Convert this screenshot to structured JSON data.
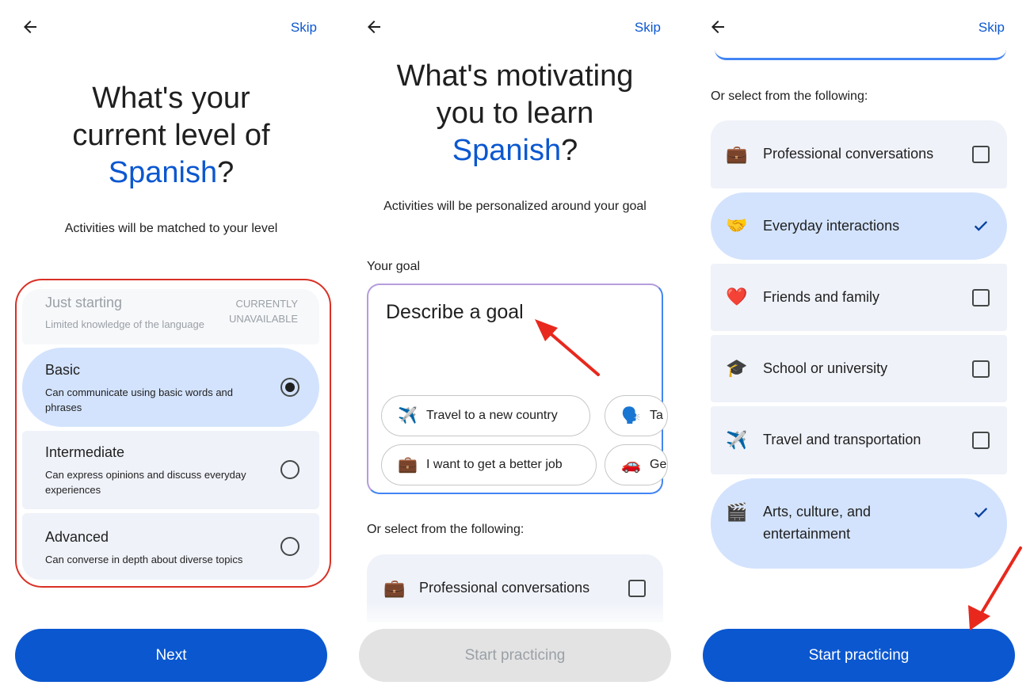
{
  "panel1": {
    "skip": "Skip",
    "title_pre": "What's your current level of",
    "title_hl": "Spanish",
    "title_post": "?",
    "subtitle": "Activities will be matched to your level",
    "levels": [
      {
        "title": "Just starting",
        "desc": "Limited knowledge of the language",
        "badge_line1": "CURRENTLY",
        "badge_line2": "UNAVAILABLE"
      },
      {
        "title": "Basic",
        "desc": "Can communicate using basic words and phrases",
        "selected": true
      },
      {
        "title": "Intermediate",
        "desc": "Can express opinions and discuss everyday experiences"
      },
      {
        "title": "Advanced",
        "desc": "Can converse in depth about diverse topics"
      }
    ],
    "next": "Next"
  },
  "panel2": {
    "skip": "Skip",
    "title_pre": "What's motivating you to learn",
    "title_hl": "Spanish",
    "title_post": "?",
    "subtitle": "Activities will be personalized around your goal",
    "goal_label": "Your goal",
    "goal_placeholder": "Describe a goal",
    "chips": [
      {
        "icon": "airplane-icon",
        "glyph": "✈️",
        "label": "Travel to a new country"
      },
      {
        "icon": "speaking-head-icon",
        "glyph": "🗣️",
        "label": "Ta"
      },
      {
        "icon": "briefcase-icon",
        "glyph": "💼",
        "label": "I want to get a better job"
      },
      {
        "icon": "car-icon",
        "glyph": "🚗",
        "label": "Ge"
      }
    ],
    "or_select": "Or select from the following:",
    "options": [
      {
        "icon": "briefcase-icon",
        "glyph": "💼",
        "label": "Professional conversations",
        "checked": false
      }
    ],
    "start": "Start practicing"
  },
  "panel3": {
    "skip": "Skip",
    "or_select": "Or select from the following:",
    "options": [
      {
        "icon": "briefcase-icon",
        "glyph": "💼",
        "label": "Professional conversations",
        "checked": false
      },
      {
        "icon": "handshake-icon",
        "glyph": "🤝",
        "label": "Everyday interactions",
        "checked": true
      },
      {
        "icon": "heart-icon",
        "glyph": "❤️",
        "label": "Friends and family",
        "checked": false
      },
      {
        "icon": "graduation-cap-icon",
        "glyph": "🎓",
        "label": "School or university",
        "checked": false
      },
      {
        "icon": "airplane-icon",
        "glyph": "✈️",
        "label": "Travel and transportation",
        "checked": false
      },
      {
        "icon": "clapper-board-icon",
        "glyph": "🎬",
        "label": "Arts, culture, and",
        "label2": "entertainment",
        "checked": true
      }
    ],
    "start": "Start practicing"
  },
  "colors": {
    "accent": "#0b57d0",
    "selected_bg": "#d3e3fd",
    "option_bg": "#eff2f9",
    "annotation_red": "#d93025"
  }
}
